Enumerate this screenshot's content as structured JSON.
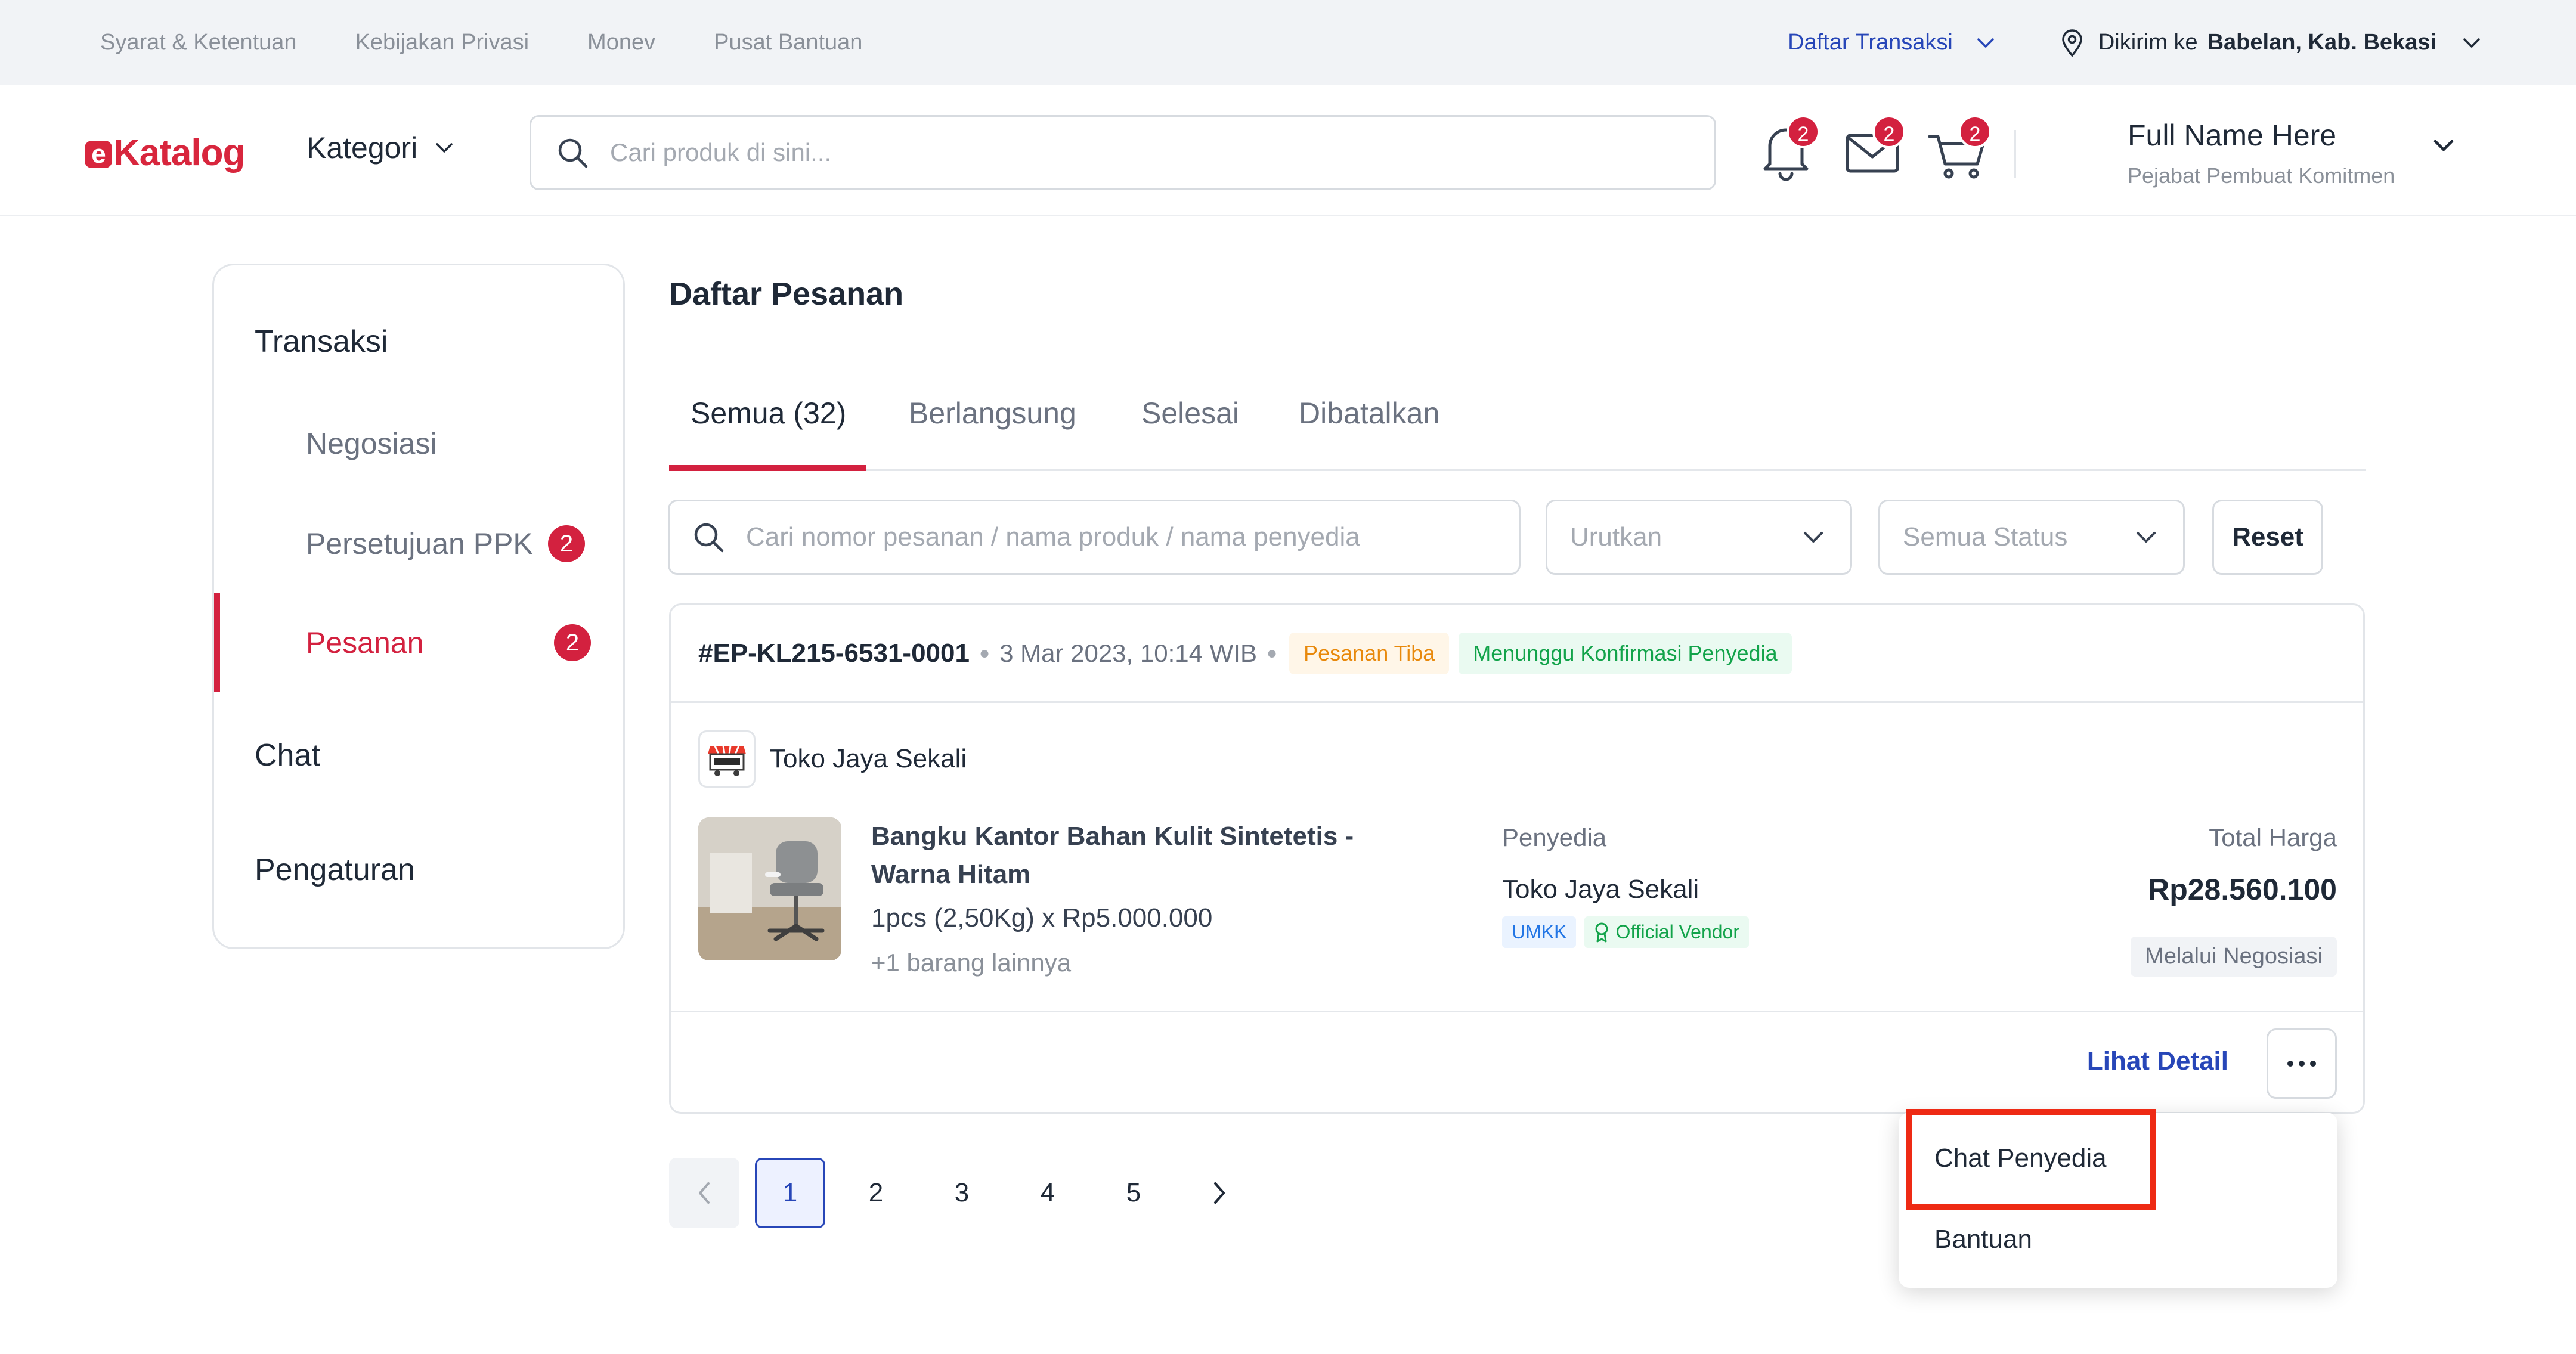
{
  "topbar": {
    "links": [
      "Syarat & Ketentuan",
      "Kebijakan Privasi",
      "Monev",
      "Pusat Bantuan"
    ],
    "transactions_label": "Daftar Transaksi",
    "ship_prefix": "Dikirim ke",
    "ship_location": "Babelan, Kab. Bekasi"
  },
  "header": {
    "logo_mark": "e",
    "logo_text": "Katalog",
    "category_label": "Kategori",
    "search_placeholder": "Cari produk di sini...",
    "notification_count": "2",
    "message_count": "2",
    "cart_count": "2",
    "user_name": "Full Name Here",
    "user_role": "Pejabat Pembuat Komitmen"
  },
  "sidebar": {
    "section_transaksi": "Transaksi",
    "items": [
      {
        "label": "Negosiasi",
        "badge": ""
      },
      {
        "label": "Persetujuan PPK",
        "badge": "2"
      },
      {
        "label": "Pesanan",
        "badge": "2"
      }
    ],
    "section_chat": "Chat",
    "section_pengaturan": "Pengaturan"
  },
  "main": {
    "title": "Daftar Pesanan",
    "tabs": [
      "Semua (32)",
      "Berlangsung",
      "Selesai",
      "Dibatalkan"
    ],
    "active_tab": 0,
    "filter_search_placeholder": "Cari nomor pesanan / nama produk / nama penyedia",
    "sort_placeholder": "Urutkan",
    "status_placeholder": "Semua Status",
    "reset_label": "Reset"
  },
  "order": {
    "number": "#EP-KL215-6531-0001",
    "date": "3 Mar 2023, 10:14 WIB",
    "status_arrival": "Pesanan Tiba",
    "status_confirm": "Menunggu Konfirmasi Penyedia",
    "store_name": "Toko Jaya Sekali",
    "product_line1": "Bangku Kantor Bahan Kulit Sintetetis -",
    "product_line2": "Warna Hitam",
    "quantity": "1pcs (2,50Kg) x Rp5.000.000",
    "more_items": "+1 barang lainnya",
    "vendor_label": "Penyedia",
    "vendor_name": "Toko Jaya Sekali",
    "vendor_tag_umkm": "UMKK",
    "vendor_tag_official": "Official Vendor",
    "total_label": "Total Harga",
    "total_price": "Rp28.560.100",
    "via": "Melalui Negosiasi",
    "detail_link": "Lihat Detail"
  },
  "dropdown": {
    "items": [
      "Chat Penyedia",
      "Bantuan"
    ]
  },
  "pagination": {
    "pages": [
      "1",
      "2",
      "3",
      "4",
      "5"
    ],
    "current": "1"
  },
  "colors": {
    "brand_red": "#d3213f",
    "link_blue": "#2746b8",
    "highlight_red": "#ee2a14"
  }
}
